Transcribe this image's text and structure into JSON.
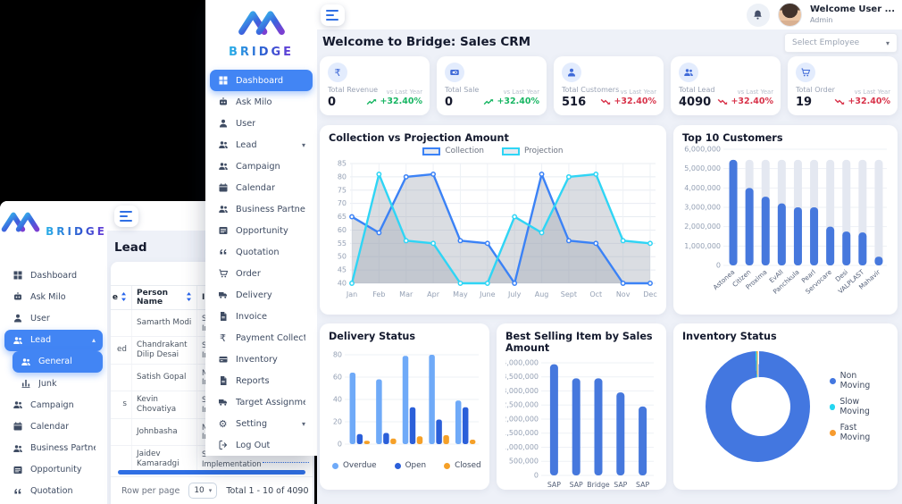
{
  "main_window": {
    "logo_text": "BRIDGE",
    "page_title": "Welcome to Bridge: Sales CRM",
    "select_employee": "Select Employee",
    "header": {
      "welcome": "Welcome User ...",
      "role": "Admin"
    },
    "sidebar": [
      {
        "label": "Dashboard",
        "icon": "grid",
        "active": true
      },
      {
        "label": "Ask Milo",
        "icon": "bot"
      },
      {
        "label": "User",
        "icon": "user"
      },
      {
        "label": "Lead",
        "icon": "people",
        "chevron": "down"
      },
      {
        "label": "Campaign",
        "icon": "people"
      },
      {
        "label": "Calendar",
        "icon": "calendar"
      },
      {
        "label": "Business Partner",
        "icon": "people"
      },
      {
        "label": "Opportunity",
        "icon": "listbox"
      },
      {
        "label": "Quotation",
        "icon": "quote"
      },
      {
        "label": "Order",
        "icon": "cart"
      },
      {
        "label": "Delivery",
        "icon": "truck"
      },
      {
        "label": "Invoice",
        "icon": "file"
      },
      {
        "label": "Payment Collection",
        "icon": "rupee"
      },
      {
        "label": "Inventory",
        "icon": "box"
      },
      {
        "label": "Reports",
        "icon": "file"
      },
      {
        "label": "Target Assignment",
        "icon": "truck"
      },
      {
        "label": "Setting",
        "icon": "gear",
        "chevron": "down"
      },
      {
        "label": "Log Out",
        "icon": "logout"
      }
    ],
    "kpis": [
      {
        "icon": "rupee",
        "label": "Total Revenue",
        "value": "0",
        "compare": "vs Last Year",
        "delta": "+32.40%",
        "trend": "up"
      },
      {
        "icon": "card",
        "label": "Total Sale",
        "value": "0",
        "compare": "vs Last Year",
        "delta": "+32.40%",
        "trend": "up"
      },
      {
        "icon": "user",
        "label": "Total Customers",
        "value": "516",
        "compare": "vs Last Year",
        "delta": "+32.40%",
        "trend": "down"
      },
      {
        "icon": "people",
        "label": "Total Lead",
        "value": "4090",
        "compare": "vs Last Year",
        "delta": "+32.40%",
        "trend": "down"
      },
      {
        "icon": "cart",
        "label": "Total Order",
        "value": "19",
        "compare": "vs Last Year",
        "delta": "+32.40%",
        "trend": "down"
      }
    ],
    "colors": {
      "accent": "#4285f4",
      "up_green": "#18b663",
      "down_red": "#d8334a"
    }
  },
  "chart_data": [
    {
      "id": "collection_projection",
      "type": "line",
      "title": "Collection vs Projection Amount",
      "x": [
        "Jan",
        "Feb",
        "Mar",
        "Apr",
        "May",
        "June",
        "July",
        "Aug",
        "Sept",
        "Oct",
        "Nov",
        "Dec"
      ],
      "series": [
        {
          "name": "Collection",
          "color": "#3b82f6",
          "values": [
            65,
            59,
            80,
            81,
            56,
            55,
            40,
            81,
            56,
            55,
            40,
            40
          ]
        },
        {
          "name": "Projection",
          "color": "#2fd5f5",
          "values": [
            40,
            81,
            56,
            55,
            40,
            40,
            65,
            59,
            80,
            81,
            56,
            55
          ]
        }
      ],
      "ylim": [
        40,
        85
      ],
      "ytick_step": 5,
      "fill": "rgba(158,165,178,0.38)",
      "legend_position": "top",
      "grid": true
    },
    {
      "id": "top_customers",
      "type": "bar",
      "title": "Top 10 Customers",
      "categories": [
        "Astonea",
        "Citizen",
        "Proxima",
        "EvAll",
        "Panchkula",
        "Pearl",
        "Servocare",
        "Desi",
        "VALPLAST",
        "Mahavir"
      ],
      "values": [
        5450000,
        4000000,
        3550000,
        3200000,
        3000000,
        3000000,
        2000000,
        1750000,
        1700000,
        450000
      ],
      "ylim": [
        0,
        6000000
      ],
      "ytick_step": 1000000,
      "bar_color": "#4678dd",
      "track_color": "#e4e8f1",
      "track_value": 5450000
    },
    {
      "id": "delivery_status",
      "type": "bar",
      "grouped": true,
      "title": "Delivery Status",
      "categories": [
        "",
        "",
        "",
        "",
        ""
      ],
      "series": [
        {
          "name": "Overdue",
          "color": "#6faaf8",
          "values": [
            64,
            58,
            79,
            80,
            39
          ]
        },
        {
          "name": "Open",
          "color": "#2b5fd9",
          "values": [
            9,
            10,
            33,
            22,
            33
          ]
        },
        {
          "name": "Closed",
          "color": "#f5a028",
          "values": [
            3,
            5,
            7,
            8,
            4
          ]
        }
      ],
      "ylim": [
        0,
        80
      ],
      "ytick_step": 20,
      "legend_position": "bottom"
    },
    {
      "id": "best_selling",
      "type": "bar",
      "title": "Best Selling Item by Sales Amount",
      "categories": [
        "SAP",
        "SAP",
        "Bridge",
        "SAP",
        "SAP"
      ],
      "values": [
        3950000,
        3450000,
        3450000,
        2950000,
        2450000
      ],
      "ylim": [
        0,
        4000000
      ],
      "ytick_step": 500000,
      "bar_color": "#4678dd"
    },
    {
      "id": "inventory_status",
      "type": "pie",
      "donut": true,
      "title": "Inventory Status",
      "labels": [
        "Non Moving",
        "Slow Moving",
        "Fast Moving"
      ],
      "values": [
        99.4,
        0.3,
        0.3
      ],
      "colors": [
        "#4377e0",
        "#24d6f1",
        "#f79b2e"
      ],
      "legend_position": "right"
    }
  ],
  "lead_window": {
    "logo_text": "BRIDGE",
    "page_title": "Lead",
    "sidebar": [
      {
        "label": "Dashboard",
        "icon": "grid"
      },
      {
        "label": "Ask Milo",
        "icon": "bot"
      },
      {
        "label": "User",
        "icon": "user"
      },
      {
        "label": "Lead",
        "icon": "people",
        "active": true,
        "chevron": "up"
      },
      {
        "label": "General",
        "icon": "people",
        "active": true,
        "sub": true
      },
      {
        "label": "Junk",
        "icon": "chart",
        "sub": true
      },
      {
        "label": "Campaign",
        "icon": "people"
      },
      {
        "label": "Calendar",
        "icon": "calendar"
      },
      {
        "label": "Business Partner",
        "icon": "people"
      },
      {
        "label": "Opportunity",
        "icon": "listbox"
      },
      {
        "label": "Quotation",
        "icon": "quote"
      }
    ],
    "table": {
      "columns": [
        {
          "label": "e",
          "sortable": true
        },
        {
          "label": "Person Name",
          "sortable": true
        },
        {
          "label": "I",
          "sortable": true
        }
      ],
      "rows": [
        {
          "col0": "",
          "name": "Samarth Modi",
          "item": "S Implementation"
        },
        {
          "col0": "ed",
          "name": "Chandrakant Dilip Desai",
          "item": "S Implementation"
        },
        {
          "col0": "",
          "name": "Satish Gopal",
          "item": "N Implementation"
        },
        {
          "col0": "s",
          "name": "Kevin Chovatiya",
          "item": "S Implementation"
        },
        {
          "col0": "",
          "name": "Johnbasha",
          "item": "N Implementation"
        },
        {
          "col0": "",
          "name": "Jaidev Kamaradgi",
          "item": "S Implementation",
          "has_link": true
        }
      ]
    },
    "pagination": {
      "rows_label": "Row per page",
      "page_size": "10",
      "total": "Total 1 - 10 of 4090"
    }
  }
}
